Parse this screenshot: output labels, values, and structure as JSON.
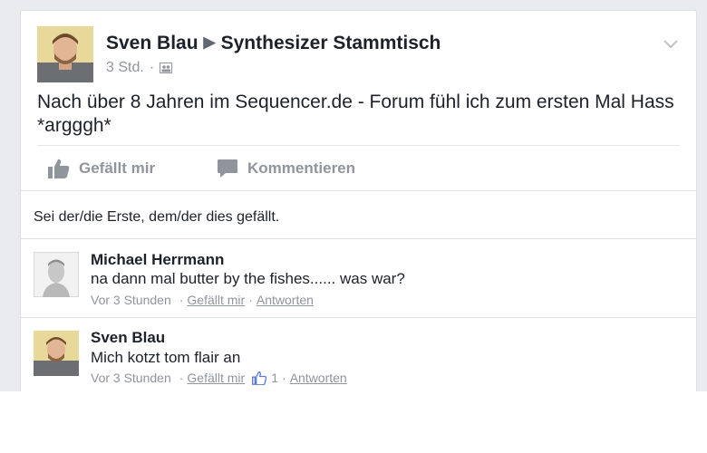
{
  "post": {
    "author": "Sven Blau",
    "group": "Synthesizer Stammtisch",
    "time": "3 Std.",
    "dot": "·",
    "text": "Nach über 8 Jahren im Sequencer.de - Forum fühl ich zum ersten Mal Hass *argggh*"
  },
  "actions": {
    "like": "Gefällt mir",
    "comment": "Kommentieren"
  },
  "likes_text": "Sei der/die Erste, dem/der dies gefällt.",
  "comments": [
    {
      "name": "Michael Herrmann",
      "text": "na dann mal butter by the fishes...... was war?",
      "time": "Vor 3 Stunden",
      "like": "Gefällt mir",
      "reply": "Antworten"
    },
    {
      "name": "Sven Blau",
      "text": "Mich kotzt tom flair an",
      "time": "Vor 3 Stunden",
      "like": "Gefällt mir",
      "like_count": "1",
      "reply": "Antworten"
    }
  ],
  "colors": {
    "page_bg": "#e9ebee",
    "text": "#1d2129",
    "muted": "#90949c"
  },
  "icons": [
    "profile-photo",
    "group-audience-icon",
    "chevron-down-icon",
    "thumbs-up-icon",
    "comment-bubble-icon"
  ]
}
